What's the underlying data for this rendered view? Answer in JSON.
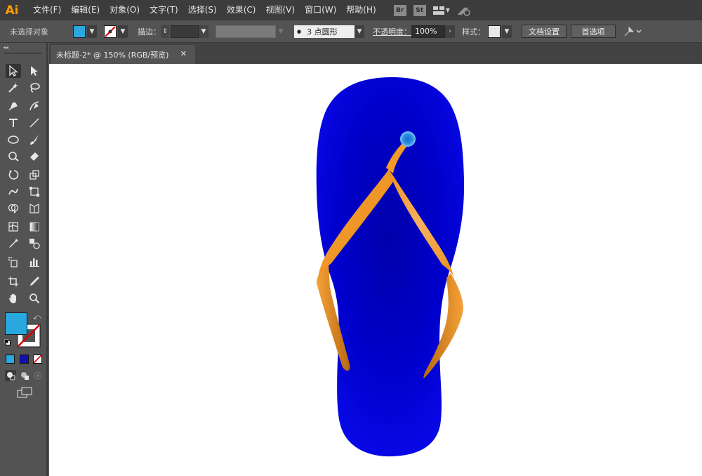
{
  "app": {
    "logo": "Ai",
    "brand_color": "#ff9a00"
  },
  "menu": [
    "文件(F)",
    "编辑(E)",
    "对象(O)",
    "文字(T)",
    "选择(S)",
    "效果(C)",
    "视图(V)",
    "窗口(W)",
    "帮助(H)"
  ],
  "menu_right": {
    "bridge": "Br",
    "stock": "St",
    "workspace_icon": "workspace-grid-icon",
    "sync_icon": "sync-icon"
  },
  "control": {
    "selection_label": "未选择对象",
    "fill_color": "#29a8e0",
    "stroke_label": "描边：",
    "brush_label": "3 点圆形",
    "opacity_label": "不透明度：",
    "opacity_value": "100%",
    "style_label": "样式：",
    "doc_setup": "文档设置",
    "preferences": "首选项"
  },
  "document_tab": {
    "title": "未标题-2* @ 150% (RGB/预览)",
    "close": "✕"
  },
  "tools": [
    "selection-tool-icon",
    "direct-selection-tool-icon",
    "magic-wand-icon",
    "lasso-icon",
    "pen-tool-icon",
    "curvature-tool-icon",
    "type-tool-icon",
    "line-tool-icon",
    "ellipse-tool-icon",
    "paintbrush-icon",
    "shaper-tool-icon",
    "eraser-icon",
    "rotate-tool-icon",
    "scale-tool-icon",
    "warp-tool-icon",
    "free-transform-icon",
    "shape-builder-icon",
    "perspective-grid-icon",
    "mesh-tool-icon",
    "gradient-tool-icon",
    "eyedropper-icon",
    "blend-tool-icon",
    "symbol-sprayer-icon",
    "graph-tool-icon",
    "artboard-tool-icon",
    "slice-tool-icon",
    "hand-tool-icon",
    "zoom-tool-icon"
  ],
  "colors": {
    "fill": "#29a8e0",
    "sole_blue": "#0000d8",
    "strap_orange": "#f39a28",
    "strap_dark": "#b86c12",
    "toggle_icon": "swap-fill-stroke-icon",
    "default_icon": "default-colors-icon"
  }
}
